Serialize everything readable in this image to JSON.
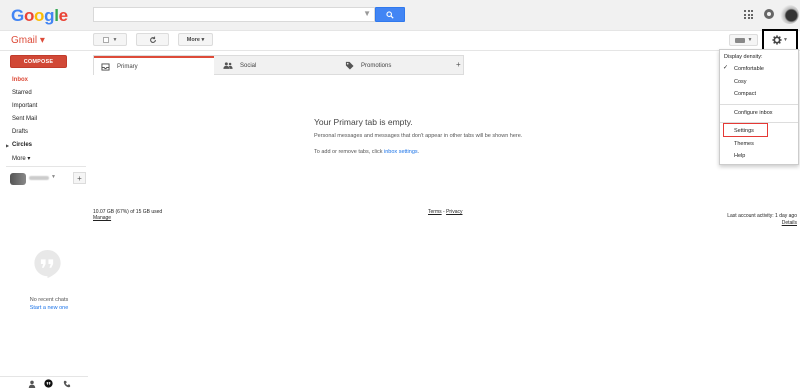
{
  "header": {
    "logo_letters": [
      "G",
      "o",
      "o",
      "g",
      "l",
      "e"
    ],
    "logo_colors": [
      "#4285f4",
      "#ea4335",
      "#fbbc05",
      "#4285f4",
      "#34a853",
      "#ea4335"
    ],
    "search": {
      "value": "",
      "placeholder": ""
    }
  },
  "toolbar": {
    "gmail_label": "Gmail ▾",
    "more_label": "More ▾"
  },
  "sidebar": {
    "compose_label": "COMPOSE",
    "items": [
      {
        "label": "Inbox"
      },
      {
        "label": "Starred"
      },
      {
        "label": "Important"
      },
      {
        "label": "Sent Mail"
      },
      {
        "label": "Drafts"
      },
      {
        "label": "Circles"
      },
      {
        "label": "More ▾"
      }
    ],
    "no_chats": "No recent chats",
    "start_new": "Start a new one"
  },
  "tabs": [
    {
      "label": "Primary",
      "icon": "inbox-icon"
    },
    {
      "label": "Social",
      "icon": "people-icon"
    },
    {
      "label": "Promotions",
      "icon": "tag-icon"
    }
  ],
  "empty_state": {
    "title": "Your Primary tab is empty.",
    "subtitle": "Personal messages and messages that don't appear in other tabs will be shown here.",
    "hint_prefix": "To add or remove tabs, click ",
    "hint_link": "inbox settings",
    "hint_suffix": "."
  },
  "footer": {
    "storage": "10.07 GB (67%) of 15 GB used",
    "manage": "Manage",
    "terms": "Terms",
    "separator": " - ",
    "privacy": "Privacy",
    "activity": "Last account activity: 1 day ago",
    "details": "Details"
  },
  "settings_menu": {
    "header": "Display density:",
    "density_options": [
      "Comfortable",
      "Cosy",
      "Compact"
    ],
    "selected_density": "Comfortable",
    "configure_inbox": "Configure inbox",
    "settings": "Settings",
    "themes": "Themes",
    "help": "Help"
  },
  "colors": {
    "accent_red": "#dd4b39",
    "compose_red": "#d14836",
    "search_blue": "#4285f4",
    "link_blue": "#1a73e8",
    "highlight_red": "#e53935"
  }
}
